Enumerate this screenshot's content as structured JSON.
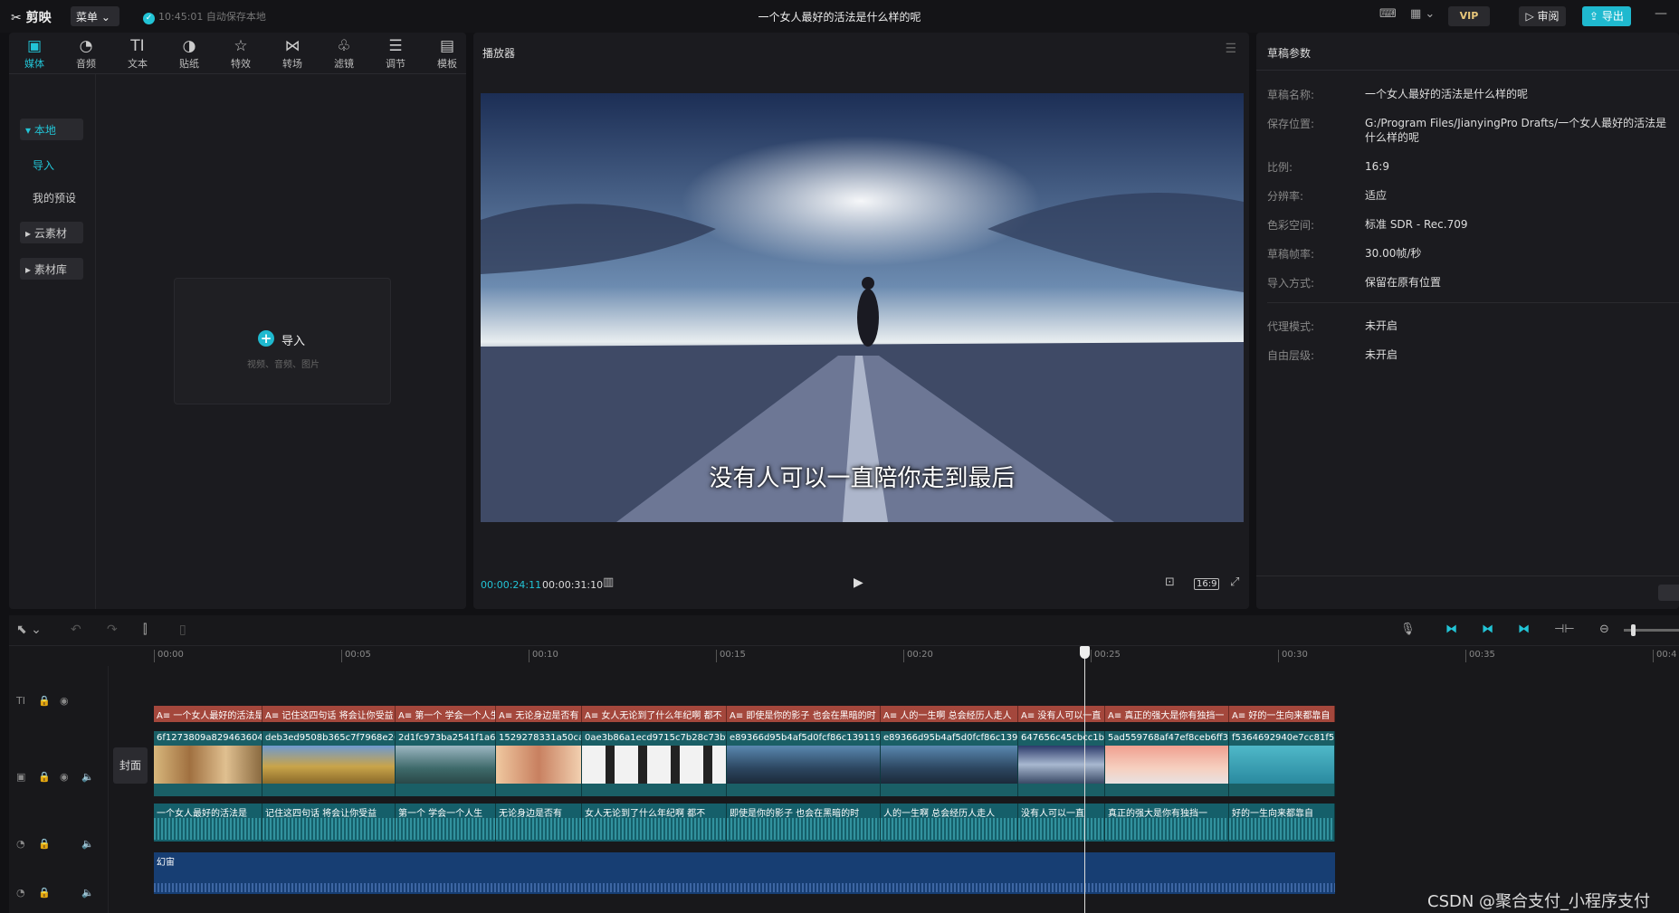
{
  "app": {
    "name": "剪映",
    "menu_label": "菜单",
    "save_status": "10:45:01 自动保存本地",
    "doc_title": "一个女人最好的活法是什么样的呢",
    "vip": "VIP",
    "review": "审阅",
    "export": "导出"
  },
  "media_tabs": [
    {
      "label": "媒体",
      "icon": "media-icon"
    },
    {
      "label": "音频",
      "icon": "audio-icon"
    },
    {
      "label": "文本",
      "icon": "text-icon"
    },
    {
      "label": "贴纸",
      "icon": "sticker-icon"
    },
    {
      "label": "特效",
      "icon": "effects-icon"
    },
    {
      "label": "转场",
      "icon": "transition-icon"
    },
    {
      "label": "滤镜",
      "icon": "filter-icon"
    },
    {
      "label": "调节",
      "icon": "adjust-icon"
    },
    {
      "label": "模板",
      "icon": "template-icon"
    }
  ],
  "sidebar": {
    "local": "本地",
    "import": "导入",
    "presets": "我的预设",
    "cloud": "云素材",
    "library": "素材库"
  },
  "import_box": {
    "label": "导入",
    "hint": "视频、音频、图片"
  },
  "player": {
    "title": "播放器",
    "subtitle": "没有人可以一直陪你走到最后",
    "current_time": "00:00:24:11",
    "total_time": "00:00:31:10",
    "ratio": "16:9"
  },
  "draft": {
    "title": "草稿参数",
    "rows": [
      {
        "k": "草稿名称:",
        "v": "一个女人最好的活法是什么样的呢"
      },
      {
        "k": "保存位置:",
        "v": "G:/Program Files/JianyingPro Drafts/一个女人最好的活法是什么样的呢"
      },
      {
        "k": "比例:",
        "v": "16:9"
      },
      {
        "k": "分辨率:",
        "v": "适应"
      },
      {
        "k": "色彩空间:",
        "v": "标准 SDR - Rec.709"
      },
      {
        "k": "草稿帧率:",
        "v": "30.00帧/秒"
      },
      {
        "k": "导入方式:",
        "v": "保留在原有位置"
      }
    ],
    "rows2": [
      {
        "k": "代理模式:",
        "v": "未开启"
      },
      {
        "k": "自由层级:",
        "v": "未开启"
      }
    ]
  },
  "timeline": {
    "ruler": [
      "00:00",
      "00:05",
      "00:10",
      "00:15",
      "00:20",
      "00:25",
      "00:30",
      "00:35",
      "00:4"
    ],
    "cover": "封面",
    "text_clips": [
      "A≡ 一个女人最好的活法是",
      "A≡ 记住这四句话 将会让你受益",
      "A≡ 第一个 学会一个人生",
      "A≡ 无论身边是否有",
      "A≡ 女人无论到了什么年纪啊 都不",
      "A≡ 即使是你的影子 也会在黑暗的时",
      "A≡ 人的一生啊 总会经历人走人",
      "A≡ 没有人可以一直",
      "A≡ 真正的强大是你有独挡一",
      "A≡ 好的一生向来都靠自"
    ],
    "video_clips": [
      "6f1273809a829463604",
      "deb3ed9508b365c7f7968e26",
      "2d1fc973ba2541f1a6c",
      "1529278331a50ca",
      "0ae3b86a1ecd9715c7b28c73bfa",
      "e89366d95b4af5d0fcf86c139119d",
      "e89366d95b4af5d0fcf86c1391",
      "647656c45cbcc1b",
      "5ad559768af47ef8ceb6ff34",
      "f5364692940e7cc81f5"
    ],
    "audio_clips": [
      "一个女人最好的活法是",
      "记住这四句话 将会让你受益",
      "第一个 学会一个人生",
      "无论身边是否有",
      "女人无论到了什么年纪啊 都不",
      "即使是你的影子 也会在黑暗的时",
      "人的一生啊 总会经历人走人",
      "没有人可以一直",
      "真正的强大是你有独挡一",
      "好的一生向来都靠自"
    ],
    "music_clip": "幻宙"
  },
  "watermark": "CSDN @聚合支付_小程序支付"
}
